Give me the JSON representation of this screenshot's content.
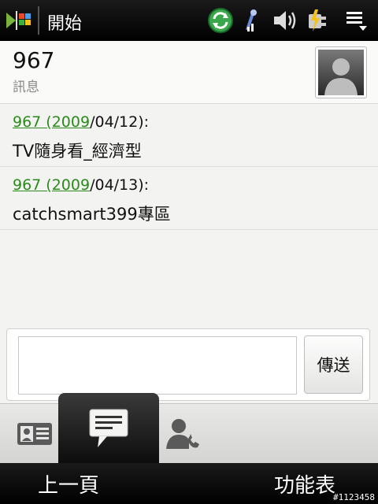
{
  "statusbar": {
    "title": "開始",
    "icons": [
      "windows-logo",
      "sync-icon",
      "signal-icon",
      "speaker-icon",
      "battery-charging-icon",
      "menu-icon"
    ]
  },
  "header": {
    "contact_name": "967",
    "subtitle": "訊息"
  },
  "messages": [
    {
      "sender_link": "967 (2009",
      "date_rest": "/04/12):",
      "body": "TV隨身看_經濟型"
    },
    {
      "sender_link": "967 (2009",
      "date_rest": "/04/13):",
      "body": "catchsmart399專區"
    }
  ],
  "compose": {
    "value": "",
    "send_label": "傳送"
  },
  "tabs": [
    "contact-card-icon",
    "message-icon",
    "call-contact-icon"
  ],
  "softkeys": {
    "left": "上一頁",
    "right": "功能表"
  },
  "watermark": "#1123458",
  "colors": {
    "link_green": "#2a8a1a",
    "bar_black": "#000000",
    "content_bg": "#f3f3f1"
  }
}
